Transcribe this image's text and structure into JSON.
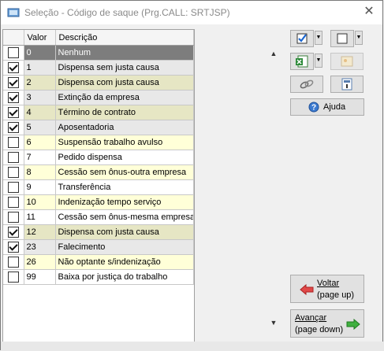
{
  "window": {
    "title": "Seleção - Código de saque (Prg.CALL: SRTJSP)"
  },
  "grid": {
    "columns": {
      "valor": "Valor",
      "descricao": "Descrição"
    },
    "rows": [
      {
        "checked": false,
        "valor": "0",
        "descricao": "Nenhum",
        "bg": "#7d7d7d",
        "selected": true
      },
      {
        "checked": true,
        "valor": "1",
        "descricao": "Dispensa sem justa causa",
        "bg": "#e8e8e8"
      },
      {
        "checked": true,
        "valor": "2",
        "descricao": "Dispensa com justa causa",
        "bg": "#e6e6c4"
      },
      {
        "checked": true,
        "valor": "3",
        "descricao": "Extinção da empresa",
        "bg": "#e8e8e8"
      },
      {
        "checked": true,
        "valor": "4",
        "descricao": "Término de contrato",
        "bg": "#e6e6c4"
      },
      {
        "checked": true,
        "valor": "5",
        "descricao": "Aposentadoria",
        "bg": "#e8e8e8"
      },
      {
        "checked": false,
        "valor": "6",
        "descricao": "Suspensão trabalho avulso",
        "bg": "#ffffd8"
      },
      {
        "checked": false,
        "valor": "7",
        "descricao": "Pedido dispensa",
        "bg": "#ffffff"
      },
      {
        "checked": false,
        "valor": "8",
        "descricao": "Cessão sem ônus-outra empresa",
        "bg": "#ffffd8"
      },
      {
        "checked": false,
        "valor": "9",
        "descricao": "Transferência",
        "bg": "#ffffff"
      },
      {
        "checked": false,
        "valor": "10",
        "descricao": "Indenização tempo serviço",
        "bg": "#ffffd8"
      },
      {
        "checked": false,
        "valor": "11",
        "descricao": "Cessão sem ônus-mesma empresa",
        "bg": "#ffffff"
      },
      {
        "checked": true,
        "valor": "12",
        "descricao": "Dispensa com justa causa",
        "bg": "#e6e6c4"
      },
      {
        "checked": true,
        "valor": "23",
        "descricao": "Falecimento",
        "bg": "#e8e8e8"
      },
      {
        "checked": false,
        "valor": "26",
        "descricao": "Não optante s/indenização",
        "bg": "#ffffd8"
      },
      {
        "checked": false,
        "valor": "99",
        "descricao": "Baixa por justiça do trabalho",
        "bg": "#ffffff"
      }
    ]
  },
  "buttons": {
    "ajuda": "Ajuda",
    "voltar": "Voltar",
    "voltar_sub": "(page up)",
    "avancar": "Avançar",
    "avancar_sub": "(page down)"
  },
  "icons": {
    "check_all": "check-all-icon",
    "uncheck_all": "uncheck-all-icon",
    "excel": "excel-export-icon",
    "image": "image-export-icon",
    "link": "link-icon",
    "calculator": "calculator-icon",
    "help": "help-icon",
    "back_arrow": "red-left-arrow-icon",
    "forward_arrow": "green-right-arrow-icon"
  },
  "colors": {
    "selected_row": "#7d7d7d",
    "yellow_row": "#ffffd8",
    "olive_row": "#e6e6c4",
    "gray_row": "#e8e8e8"
  }
}
